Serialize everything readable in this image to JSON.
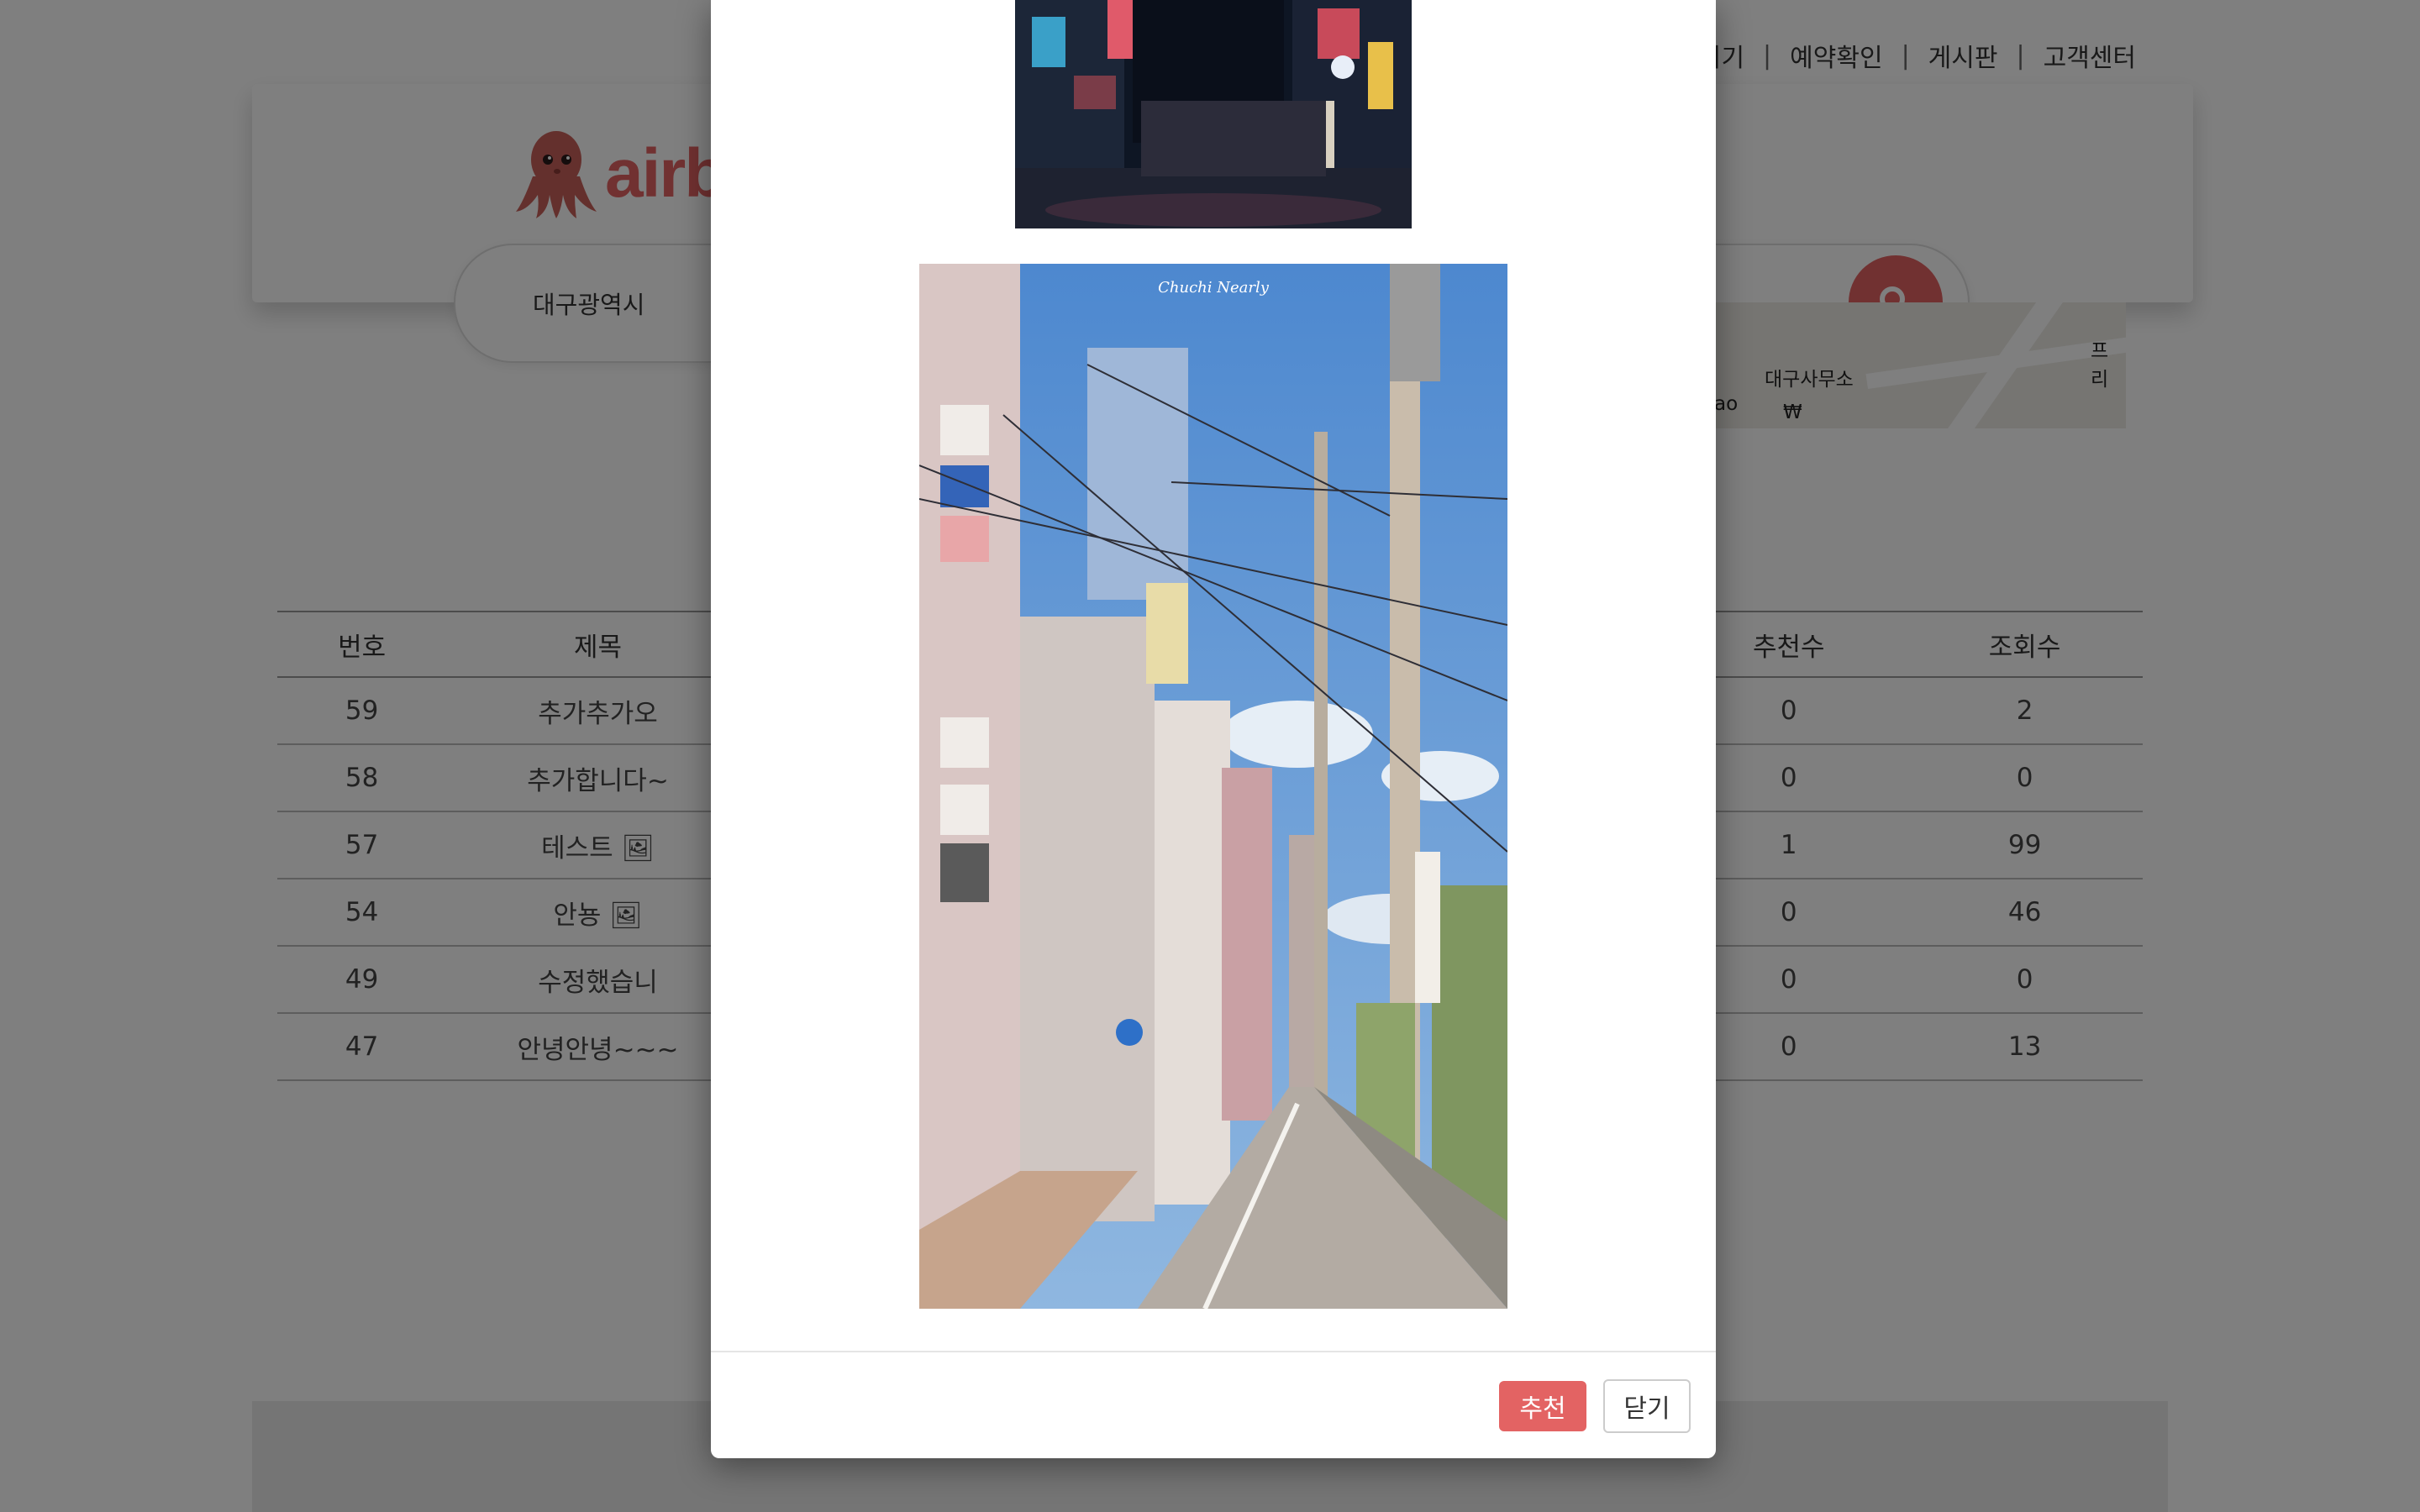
{
  "topnav": {
    "items": [
      "되기",
      "예약확인",
      "게시판",
      "고객센터"
    ],
    "separator": "|"
  },
  "logo": {
    "text": "airb",
    "brand_color": "#e36363"
  },
  "search": {
    "value": "대구광역시"
  },
  "map": {
    "labels": [
      "프리",
      "대구사무소",
      "ao",
      "₩"
    ]
  },
  "board": {
    "headers": [
      "번호",
      "제목",
      "추천수",
      "조회수"
    ],
    "rows": [
      {
        "no": "59",
        "title": "추가추가오",
        "recommend": "0",
        "views": "2"
      },
      {
        "no": "58",
        "title": "추가합니다~",
        "recommend": "0",
        "views": "0"
      },
      {
        "no": "57",
        "title": "테스트",
        "recommend": "1",
        "views": "99"
      },
      {
        "no": "54",
        "title": "안뇽",
        "recommend": "0",
        "views": "46"
      },
      {
        "no": "49",
        "title": "수정했습니",
        "recommend": "0",
        "views": "0"
      },
      {
        "no": "47",
        "title": "안녕안녕~~~",
        "recommend": "0",
        "views": "13"
      }
    ]
  },
  "modal": {
    "photo2_signature": "Chuchi Nearly",
    "recommend_label": "추천",
    "close_label": "닫기"
  }
}
